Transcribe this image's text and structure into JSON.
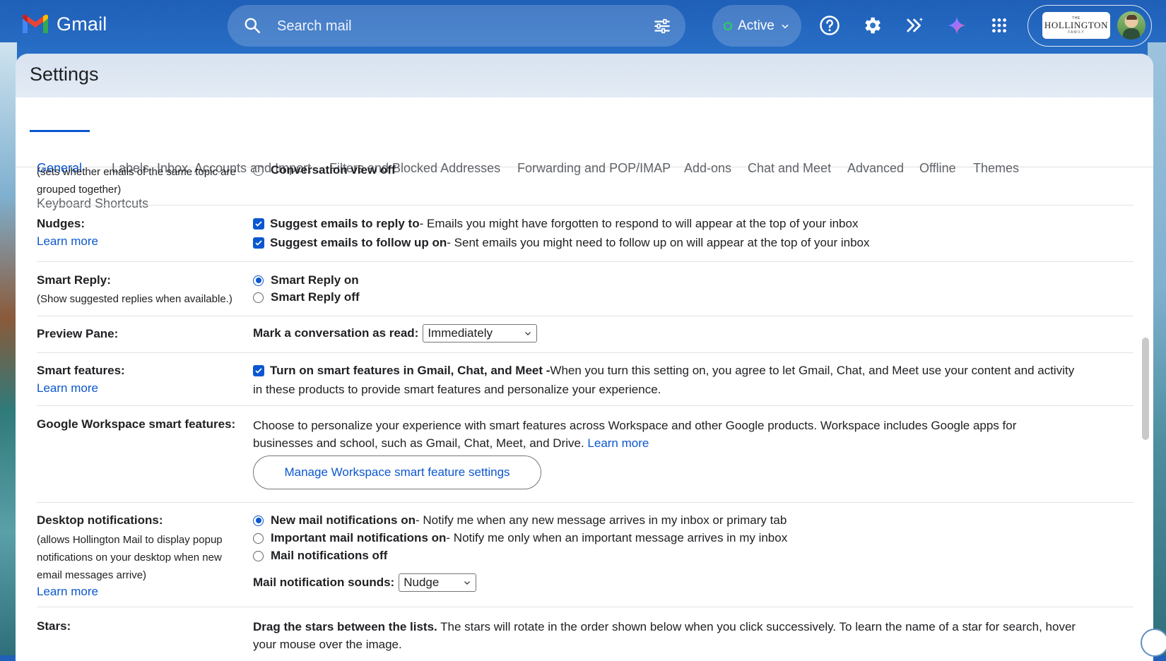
{
  "app": {
    "name": "Gmail"
  },
  "search": {
    "placeholder": "Search mail"
  },
  "status": {
    "label": "Active"
  },
  "account": {
    "org_the": "THE",
    "org_name": "HOLLINGTON",
    "org_family": "FAMILY"
  },
  "settings": {
    "title": "Settings",
    "tabs": [
      "General",
      "Labels",
      "Inbox",
      "Accounts and Import",
      "Filters and Blocked Addresses",
      "Forwarding and POP/IMAP",
      "Add-ons",
      "Chat and Meet",
      "Advanced",
      "Offline",
      "Themes",
      "Keyboard Shortcuts"
    ],
    "active_tab": "General"
  },
  "conversation": {
    "desc_line1": "(sets whether emails of the same topic are",
    "desc_line2": "grouped together)",
    "off_label": "Conversation view off"
  },
  "nudges": {
    "label": "Nudges:",
    "learn_more": "Learn more",
    "opt1_bold": "Suggest emails to reply to",
    "opt1_desc": " - Emails you might have forgotten to respond to will appear at the top of your inbox",
    "opt2_bold": "Suggest emails to follow up on",
    "opt2_desc": " - Sent emails you might need to follow up on will appear at the top of your inbox"
  },
  "smart_reply": {
    "label": "Smart Reply:",
    "desc": "(Show suggested replies when available.)",
    "on": "Smart Reply on",
    "off": "Smart Reply off"
  },
  "preview_pane": {
    "label": "Preview Pane:",
    "mark_label": "Mark a conversation as read:",
    "mark_value": "Immediately"
  },
  "smart_features": {
    "label": "Smart features:",
    "learn_more": "Learn more",
    "bold": "Turn on smart features in Gmail, Chat, and Meet -",
    "line1_rest": " When you turn this setting on, you agree to let Gmail, Chat, and Meet use your content and activity",
    "line2": "in these products to provide smart features and personalize your experience."
  },
  "workspace": {
    "label": "Google Workspace smart features:",
    "line1": "Choose to personalize your experience with smart features across Workspace and other Google products. Workspace includes Google apps for",
    "line2": "businesses and school, such as Gmail, Chat, Meet, and Drive. ",
    "learn_more": "Learn more",
    "button": "Manage Workspace smart feature settings"
  },
  "desktop_notifications": {
    "label": "Desktop notifications:",
    "desc_line1": "(allows Hollington Mail to display popup",
    "desc_line2": "notifications on your desktop when new",
    "desc_line3": "email messages arrive)",
    "learn_more": "Learn more",
    "opt1_bold": "New mail notifications on",
    "opt1_desc": " - Notify me when any new message arrives in my inbox or primary tab",
    "opt2_bold": "Important mail notifications on",
    "opt2_desc": " - Notify me only when an important message arrives in my inbox",
    "opt3_bold": "Mail notifications off",
    "sound_label": "Mail notification sounds:",
    "sound_value": "Nudge"
  },
  "stars": {
    "label": "Stars:",
    "bold": "Drag the stars between the lists.",
    "line1_rest": "  The stars will rotate in the order shown below when you click successively. To learn the name of a star for search, hover",
    "line2": "your mouse over the image."
  }
}
